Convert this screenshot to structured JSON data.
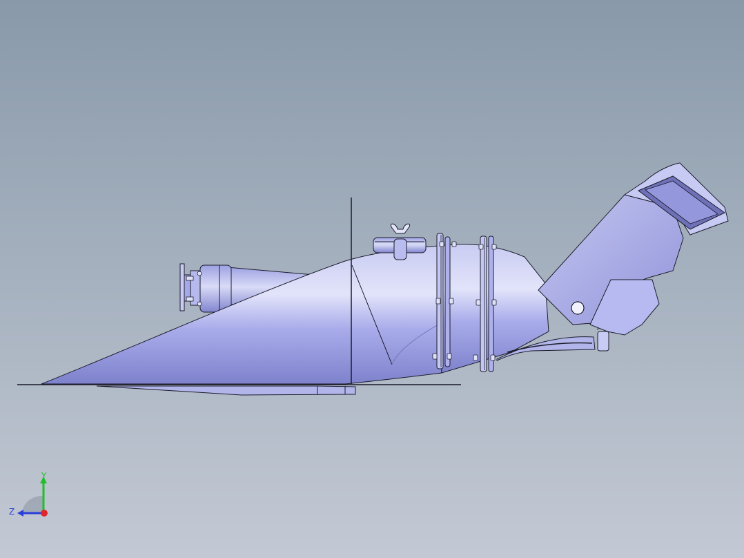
{
  "triad": {
    "y_label": "Y",
    "z_label": "Z",
    "colors": {
      "y_axis": "#1fbf2a",
      "z_axis": "#2a3fd8",
      "x_axis": "#e0262a"
    }
  },
  "model": {
    "body_color": "#a6a9e8",
    "shade_color": "#7d80c8",
    "highlight_color": "#dfe1f8",
    "edge_color": "#1b1b2a"
  }
}
